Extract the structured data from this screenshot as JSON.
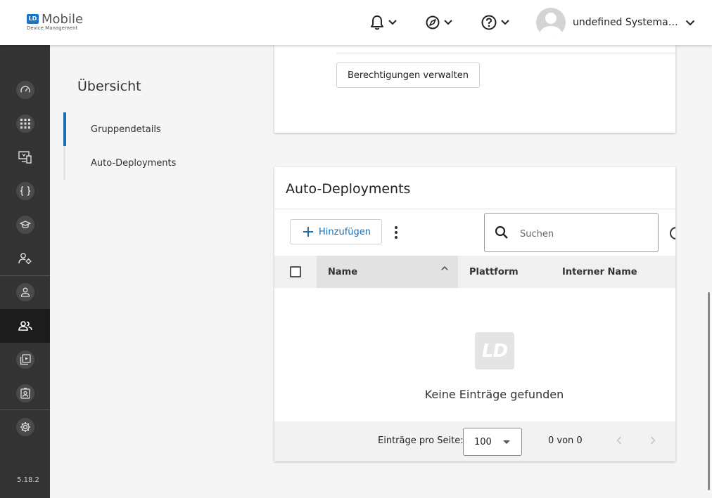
{
  "app": {
    "logo_mark": "LD",
    "logo_title": "Mobile",
    "logo_subtitle": "Device Management",
    "version": "5.18.2"
  },
  "topbar": {
    "notifications_icon": "bell-icon",
    "messages_icon": "compass-icon",
    "help_icon": "help-icon",
    "user_name": "undefined Systemadministrator"
  },
  "sidebar": {
    "items": [
      {
        "name": "dashboard",
        "icon": "speedometer-icon"
      },
      {
        "name": "apps",
        "icon": "grid-icon"
      },
      {
        "name": "devices",
        "icon": "devices-icon"
      },
      {
        "name": "scripts",
        "icon": "braces-icon"
      },
      {
        "name": "training",
        "icon": "graduation-cap-icon"
      },
      {
        "name": "user-settings",
        "icon": "user-gear-icon"
      },
      {
        "name": "users",
        "icon": "user-icon"
      },
      {
        "name": "groups",
        "icon": "group-icon",
        "active": true
      },
      {
        "name": "deployments",
        "icon": "media-stack-icon"
      },
      {
        "name": "badge",
        "icon": "badge-icon"
      },
      {
        "name": "settings",
        "icon": "gear-icon"
      }
    ]
  },
  "section_nav": {
    "title": "Übersicht",
    "items": [
      {
        "label": "Gruppendetails",
        "active": true
      },
      {
        "label": "Auto-Deployments",
        "active": false
      }
    ]
  },
  "permissions_card": {
    "manage_button": "Berechtigungen verwalten"
  },
  "auto_deployments": {
    "title": "Auto-Deployments",
    "add_button": "Hinzufügen",
    "search_placeholder": "Suchen",
    "columns": [
      "Name",
      "Plattform",
      "Interner Name"
    ],
    "sorted_column": "Name",
    "empty_logo_text": "LD",
    "empty_message": "Keine Einträge gefunden",
    "footer": {
      "per_page_label": "Einträge pro Seite:",
      "per_page_value": "100",
      "range_text": "0 von 0"
    }
  }
}
